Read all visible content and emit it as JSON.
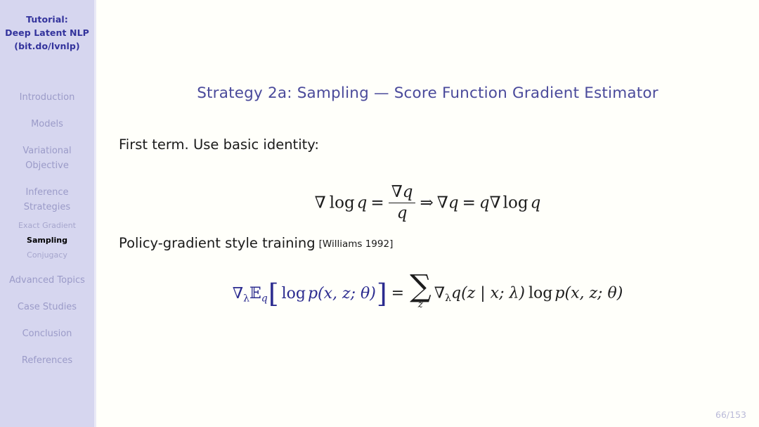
{
  "sidebar": {
    "brand": {
      "line1": "Tutorial:",
      "line2": "Deep Latent NLP",
      "line3": "(bit.do/lvnlp)"
    },
    "items": [
      {
        "label": "Introduction",
        "lines": [
          "Introduction"
        ],
        "active": false
      },
      {
        "label": "Models",
        "lines": [
          "Models"
        ],
        "active": false
      },
      {
        "label": "Variational Objective",
        "lines": [
          "Variational",
          "Objective"
        ],
        "active": false
      },
      {
        "label": "Inference Strategies",
        "lines": [
          "Inference",
          "Strategies"
        ],
        "active": false
      },
      {
        "label": "Advanced Topics",
        "lines": [
          "Advanced Topics"
        ],
        "active": false
      },
      {
        "label": "Case Studies",
        "lines": [
          "Case Studies"
        ],
        "active": false
      },
      {
        "label": "Conclusion",
        "lines": [
          "Conclusion"
        ],
        "active": false
      },
      {
        "label": "References",
        "lines": [
          "References"
        ],
        "active": false
      }
    ],
    "subitems": [
      {
        "label": "Exact Gradient",
        "active": false
      },
      {
        "label": "Sampling",
        "active": true
      },
      {
        "label": "Conjugacy",
        "active": false
      }
    ]
  },
  "main": {
    "title": "Strategy 2a: Sampling — Score Function Gradient Estimator",
    "first_term_text": "First term. Use basic identity:",
    "policy_text": "Policy-gradient style training",
    "policy_citation": "[Williams 1992]",
    "equation1": {
      "latex": "\\nabla \\log q = \\frac{\\nabla q}{q} \\Rightarrow \\nabla q = q \\nabla \\log q",
      "plain": "∇ log q = ∇q / q  ⇒  ∇q = q∇ log q",
      "nabla": "∇",
      "log": "log",
      "q": "q",
      "equals": "=",
      "implies": "⇒"
    },
    "equation2": {
      "latex": "\\nabla_\\lambda \\mathbb{E}_q \\left[ \\log p(x, z; \\theta) \\right] = \\sum_z \\nabla_\\lambda q(z \\mid x; \\lambda) \\log p(x, z; \\theta)",
      "plain": "∇_λ E_q [ log p(x, z; θ) ] = ∑_z ∇_λ q(z | x; λ) log p(x, z; θ)",
      "lhs": {
        "nabla": "∇",
        "lambda": "λ",
        "expectation": "𝔼",
        "q": "q",
        "bracket_open": "[",
        "log": "log",
        "p": "p",
        "args": "(x, z; θ)",
        "bracket_close": "]"
      },
      "equals": "=",
      "rhs": {
        "sum": "∑",
        "sum_index": "z",
        "nabla": "∇",
        "lambda": "λ",
        "q": "q",
        "q_args": "(z | x; λ)",
        "log": "log",
        "p": "p",
        "p_args": "(x, z; θ)"
      }
    }
  },
  "footer": {
    "page": "66/153"
  },
  "colors": {
    "sidebar_background": "#d6d6ef",
    "content_background": "#fffffa",
    "brand_text": "#33339c",
    "nav_text": "#9b9bc8",
    "nav_active_text": "#000000",
    "title_text": "#4a4a9b",
    "body_text": "#1a1a1a",
    "math_highlight": "#2b2b8f",
    "page_number": "#b9b9d8"
  }
}
